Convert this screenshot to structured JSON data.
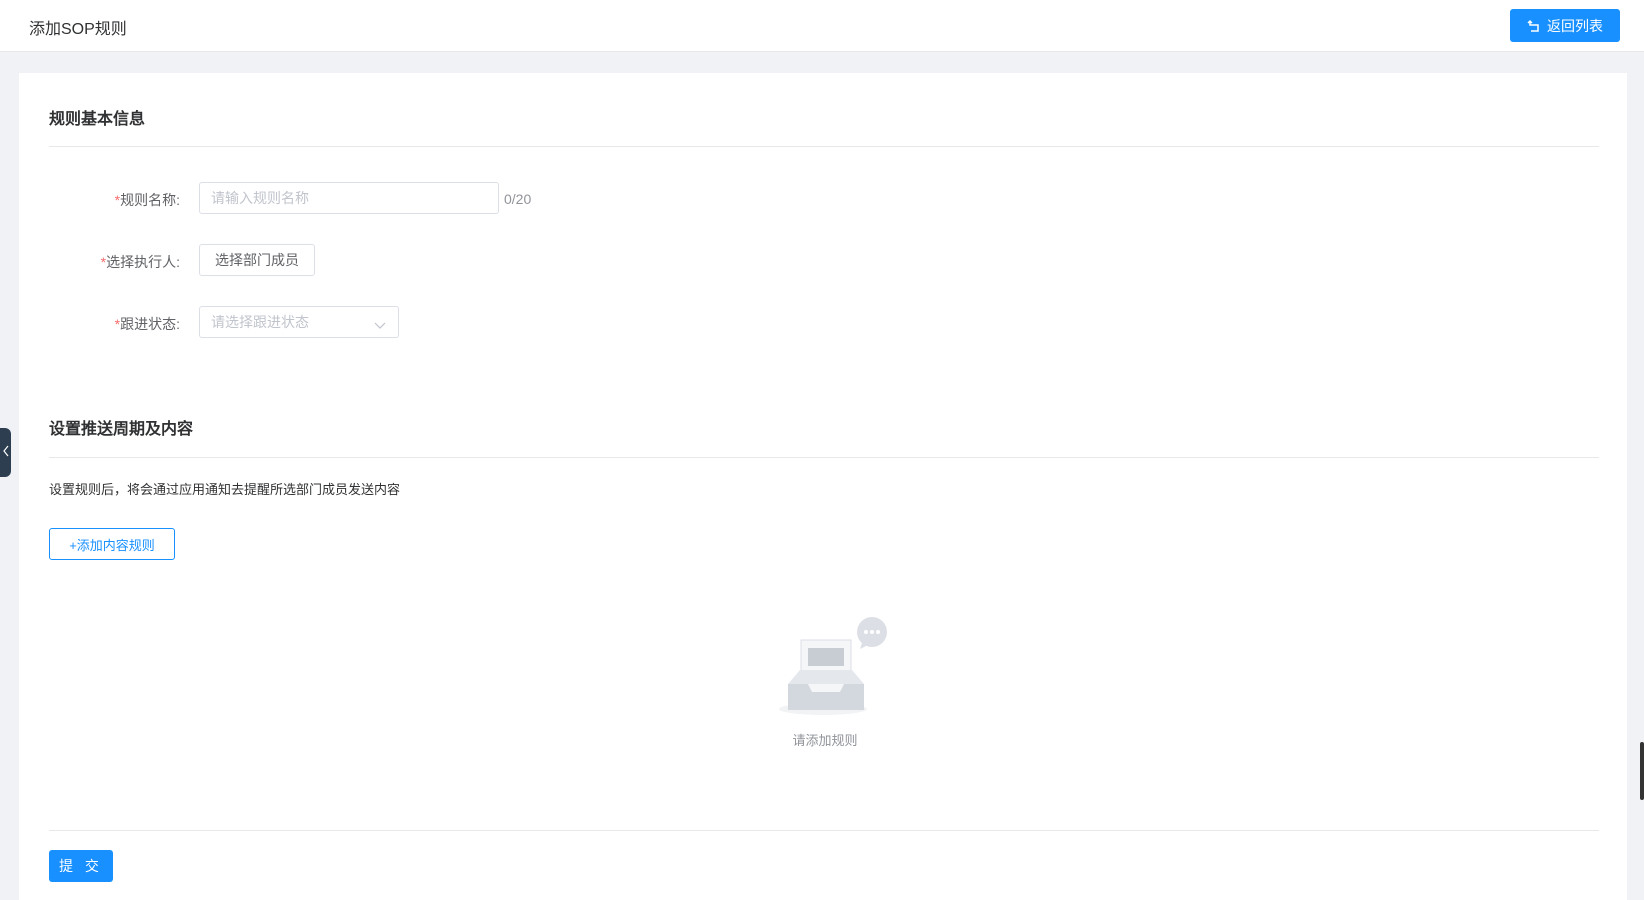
{
  "header": {
    "title": "添加SOP规则",
    "back_label": "返回列表"
  },
  "basic_info": {
    "title": "规则基本信息",
    "rule_name": {
      "label": "规则名称:",
      "placeholder": "请输入规则名称",
      "count": "0/20"
    },
    "executor": {
      "label": "选择执行人:",
      "button": "选择部门成员"
    },
    "status": {
      "label": "跟进状态:",
      "placeholder": "请选择跟进状态"
    },
    "required_mark": "*"
  },
  "push_section": {
    "title": "设置推送周期及内容",
    "hint": "设置规则后，将会通过应用通知去提醒所选部门成员发送内容",
    "add_button": "+添加内容规则",
    "empty_text": "请添加规则"
  },
  "footer": {
    "submit_label": "提 交"
  },
  "icons": {
    "back": "return-icon",
    "chevron": "chevron-down-icon",
    "sidebar": "chevron-left-icon"
  },
  "colors": {
    "primary": "#1890ff",
    "required": "#f56c6c"
  }
}
